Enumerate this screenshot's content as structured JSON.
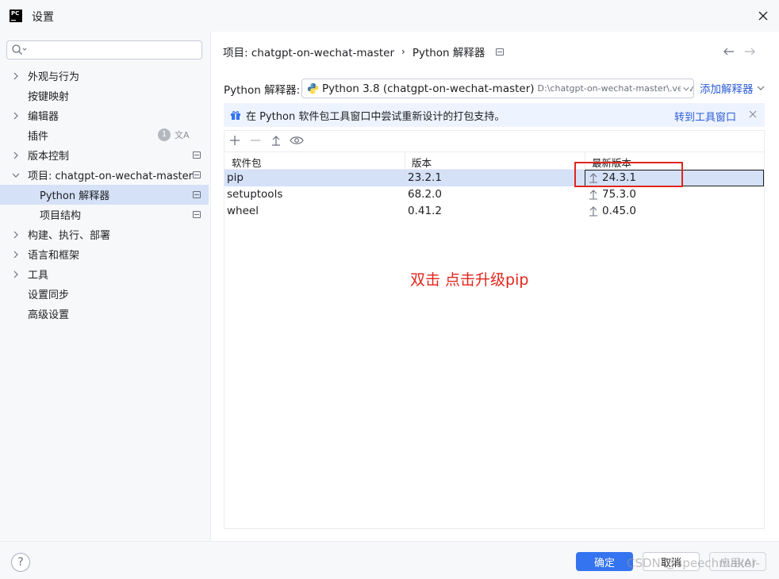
{
  "window": {
    "title": "设置",
    "logo_text": "PC"
  },
  "sidebar": {
    "search_placeholder": "",
    "items": [
      {
        "label": "外观与行为",
        "expandable": true
      },
      {
        "label": "按键映射"
      },
      {
        "label": "编辑器",
        "expandable": true
      },
      {
        "label": "插件",
        "badge": "1",
        "extra": "文A"
      },
      {
        "label": "版本控制",
        "expandable": true
      },
      {
        "label": "项目: chatgpt-on-wechat-master",
        "expanded": true
      },
      {
        "label": "Python 解释器",
        "selected": true
      },
      {
        "label": "项目结构"
      },
      {
        "label": "构建、执行、部署",
        "expandable": true
      },
      {
        "label": "语言和框架",
        "expandable": true
      },
      {
        "label": "工具",
        "expandable": true
      },
      {
        "label": "设置同步"
      },
      {
        "label": "高级设置"
      }
    ]
  },
  "breadcrumb": {
    "project": "项目: chatgpt-on-wechat-master",
    "sep": "›",
    "page": "Python 解释器"
  },
  "interpreter": {
    "label": "Python 解释器:",
    "value": "Python 3.8 (chatgpt-on-wechat-master)",
    "path": "D:\\chatgpt-on-wechat-master\\.venv\\",
    "add_label": "添加解释器"
  },
  "banner": {
    "text": "在 Python 软件包工具窗口中尝试重新设计的打包支持。",
    "link": "转到工具窗口"
  },
  "table": {
    "headers": [
      "软件包",
      "版本",
      "最新版本"
    ],
    "rows": [
      {
        "package": "pip",
        "version": "23.2.1",
        "latest": "24.3.1"
      },
      {
        "package": "setuptools",
        "version": "68.2.0",
        "latest": "75.3.0"
      },
      {
        "package": "wheel",
        "version": "0.41.2",
        "latest": "0.45.0"
      }
    ]
  },
  "annotation": "双击 点击升级pip",
  "footer": {
    "ok": "确定",
    "cancel": "取消",
    "apply": "应用(A)",
    "help": "?"
  },
  "watermark": "CSDN @speechmaker-",
  "colors": {
    "accent": "#3574f0",
    "selection": "#d5e1f7",
    "annotation": "#e0261b",
    "link": "#2d5dd7"
  }
}
